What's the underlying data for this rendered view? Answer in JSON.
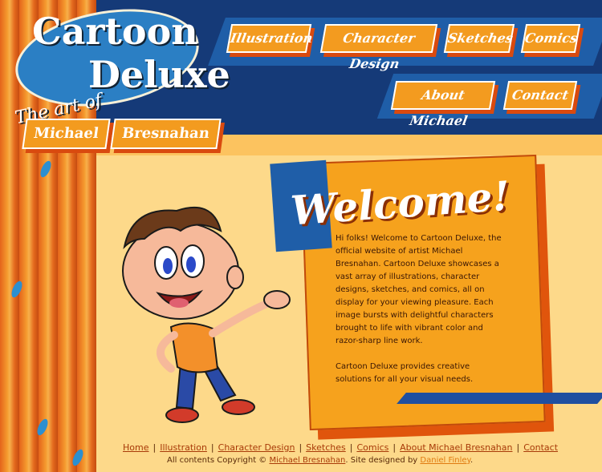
{
  "logo": {
    "line1": "Cartoon",
    "line2": "Deluxe",
    "subtitle": "The art of",
    "first_name": "Michael",
    "last_name": "Bresnahan"
  },
  "nav": {
    "items": [
      {
        "label": "Illustration"
      },
      {
        "label": "Character Design"
      },
      {
        "label": "Sketches"
      },
      {
        "label": "Comics"
      },
      {
        "label": "About Michael"
      },
      {
        "label": "Contact"
      }
    ]
  },
  "welcome": {
    "title": "Welcome!",
    "paragraph1": "Hi folks! Welcome to Cartoon Deluxe, the official website of artist Michael Bresnahan. Cartoon Deluxe showcases a vast array of illustrations, character designs, sketches, and comics, all on display for your viewing pleasure. Each image bursts with delightful characters brought to life with vibrant color and razor-sharp line work.",
    "paragraph2": "Cartoon Deluxe provides creative solutions for all your visual needs."
  },
  "footer": {
    "links": [
      "Home",
      "Illustration",
      "Character Design",
      "Sketches",
      "Comics",
      "About Michael Bresnahan",
      "Contact"
    ],
    "separator": "|",
    "copyright_prefix": "All contents Copyright ©",
    "copyright_owner": "Michael Bresnahan",
    "designed_prefix": ". Site designed by",
    "designer": "Daniel Finley",
    "end": "."
  },
  "colors": {
    "header_navy": "#153a78",
    "accent_orange": "#f39b1f",
    "background": "#fdd98a"
  }
}
